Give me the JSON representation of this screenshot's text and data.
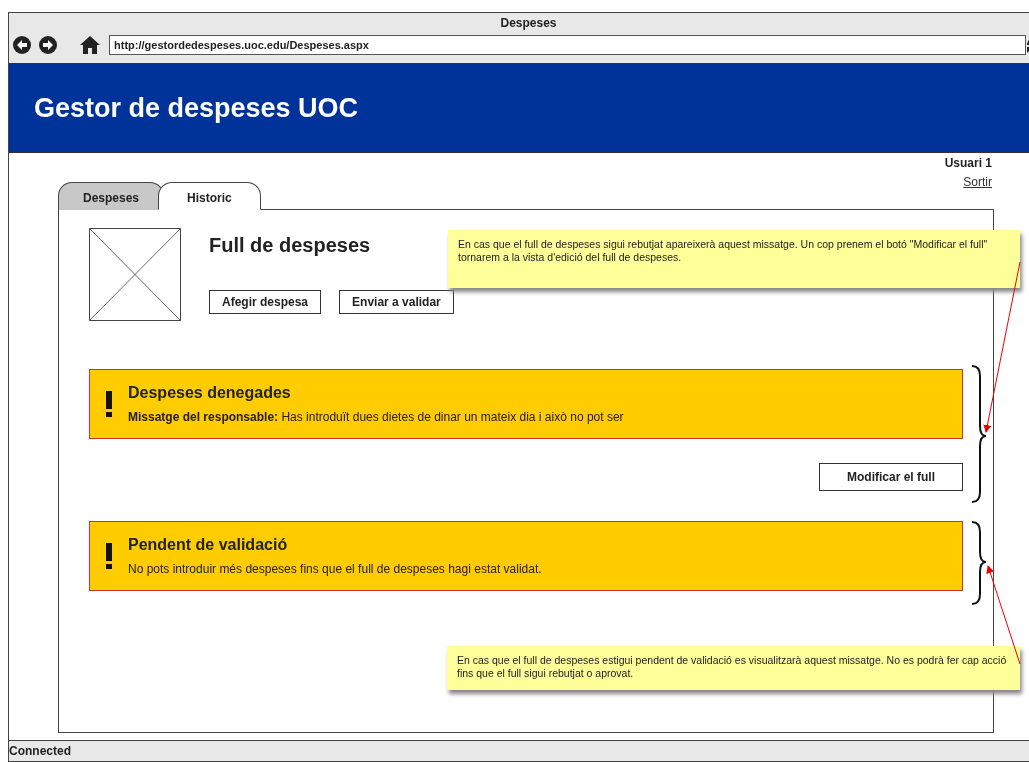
{
  "window": {
    "title": "Despeses",
    "address": "http://gestordedespeses.uoc.edu/Despeses.aspx"
  },
  "app_header": {
    "title": "Gestor de despeses UOC"
  },
  "user": {
    "name": "Usuari 1",
    "logout": "Sortir"
  },
  "tabs": [
    {
      "label": "Despeses",
      "selected": false
    },
    {
      "label": "Historic",
      "selected": true
    }
  ],
  "sheet": {
    "title": "Full de despeses",
    "buttons": [
      "Afegir despesa",
      "Enviar a validar"
    ]
  },
  "alerts": [
    {
      "title": "Despeses denegades",
      "message": "**Missatge del responsable:**  Has introduït dues dietes de dinar un mateix dia i això no pot ser",
      "action": "Modificar el full"
    },
    {
      "title": "Pendent de validació",
      "message": "No pots introduir més despeses fins que el full de despeses hagi estat validat."
    }
  ],
  "notes": [
    "En cas que el full de despeses sigui rebutjat apareixerà aquest missatge. Un cop prenem el botó \"Modificar el full\" tornarem a la vista d'edició del full de despeses.",
    "En cas que el full de despeses estigui pendent de validació es visualitzarà aquest missatge. No es podrà fer cap acció fins que el full sigui rebutjat o aprovat."
  ],
  "status_bar": "Connected"
}
